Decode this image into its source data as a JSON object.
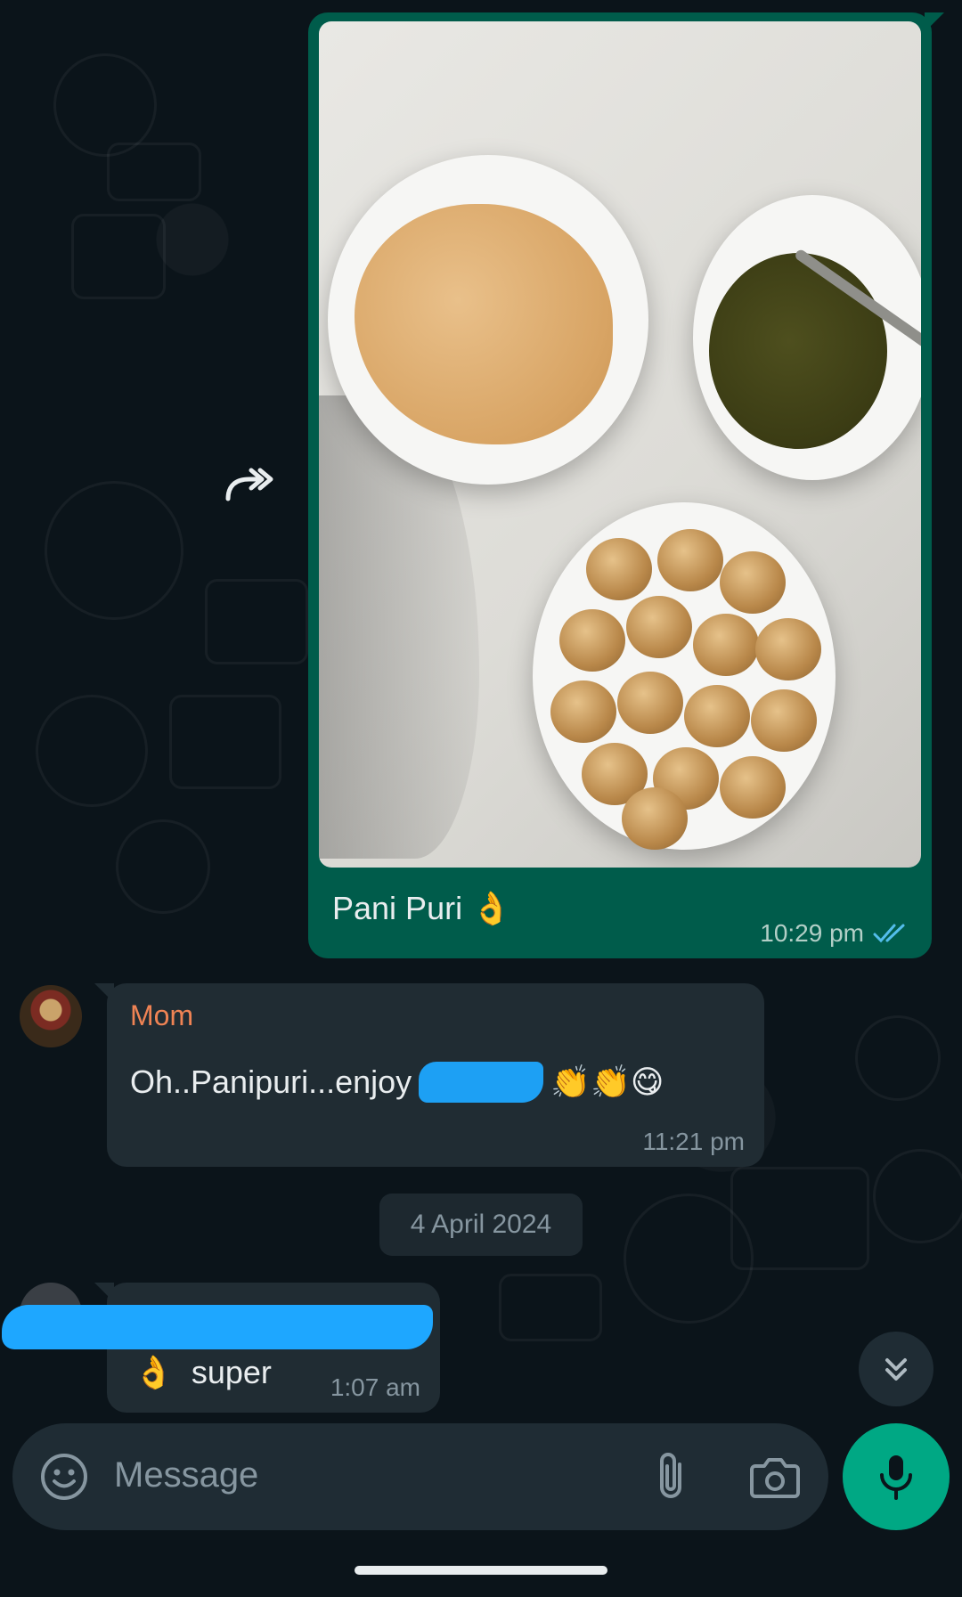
{
  "messages": {
    "outgoing_image": {
      "caption": "Pani Puri",
      "caption_emoji": "👌",
      "time": "10:29 pm",
      "status": "read"
    },
    "mom_message": {
      "sender": "Mom",
      "text": "Oh..Panipuri...enjoy",
      "emojis": "👏👏😋",
      "time": "11:21 pm"
    },
    "date_separator": "4 April 2024",
    "second_message": {
      "emoji": "👌",
      "text": "super",
      "time": "1:07 am"
    }
  },
  "composer": {
    "placeholder": "Message"
  },
  "colors": {
    "background": "#0b141a",
    "outgoing_bubble": "#005c4b",
    "incoming_bubble": "#202c33",
    "sender_name": "#ef8354",
    "read_ticks": "#53bdeb",
    "mic_button": "#00a884"
  },
  "icons": [
    "forward-icon",
    "emoji-icon",
    "attach-icon",
    "camera-icon",
    "mic-icon",
    "scroll-down-icon",
    "read-ticks-icon"
  ]
}
